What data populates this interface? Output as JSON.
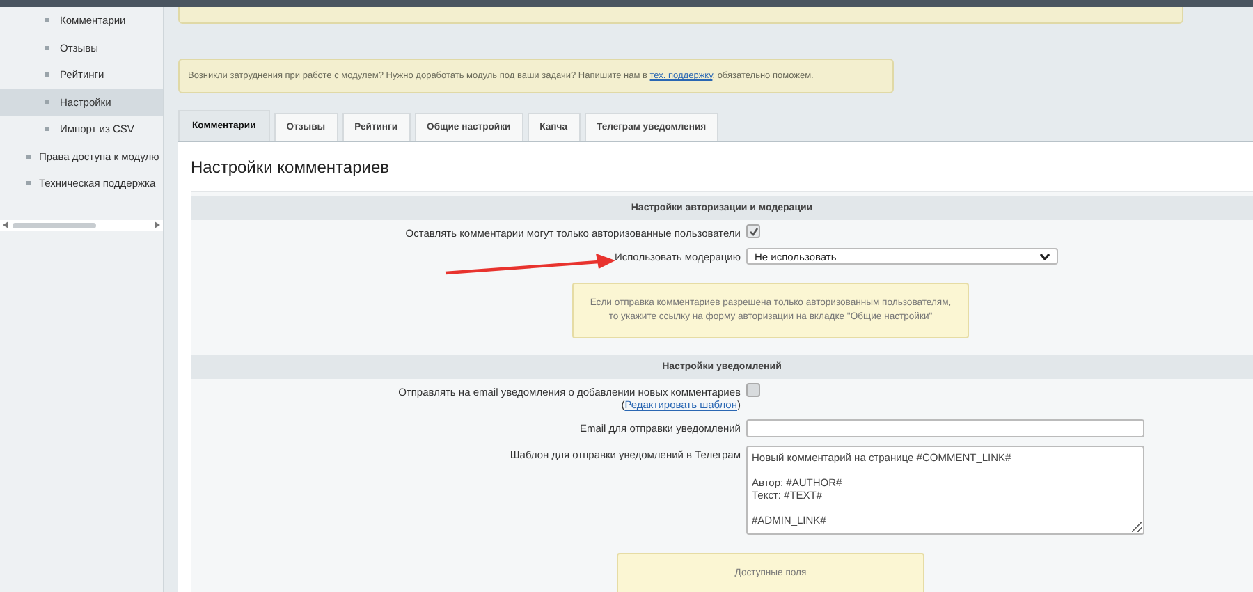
{
  "sidebar": {
    "items": [
      {
        "label": "Комментарии",
        "kind": "sub",
        "selected": false
      },
      {
        "label": "Отзывы",
        "kind": "sub",
        "selected": false
      },
      {
        "label": "Рейтинги",
        "kind": "sub",
        "selected": false
      },
      {
        "label": "Настройки",
        "kind": "sub",
        "selected": true
      },
      {
        "label": "Импорт из CSV",
        "kind": "sub",
        "selected": false
      },
      {
        "label": "Права доступа к модулю",
        "kind": "top",
        "selected": false
      },
      {
        "label": "Техническая поддержка",
        "kind": "top",
        "selected": false
      }
    ]
  },
  "notice": {
    "before": "Возникли затруднения при работе с модулем? Нужно доработать модуль под ваши задачи? Напишите нам в ",
    "link": "тех. поддержку",
    "after": ", обязательно поможем."
  },
  "tabs": [
    {
      "label": "Комментарии",
      "selected": true
    },
    {
      "label": "Отзывы",
      "selected": false
    },
    {
      "label": "Рейтинги",
      "selected": false
    },
    {
      "label": "Общие настройки",
      "selected": false
    },
    {
      "label": "Капча",
      "selected": false
    },
    {
      "label": "Телеграм уведомления",
      "selected": false
    }
  ],
  "page_title": "Настройки комментариев",
  "sections": [
    {
      "heading": "Настройки авторизации и модерации",
      "rows": [
        {
          "kind": "checkbox",
          "label": "Оставлять комментарии могут только авторизованные пользователи",
          "checked": true
        },
        {
          "kind": "select",
          "label": "Использовать модерацию",
          "value": "Не использовать"
        },
        {
          "kind": "hint",
          "lines": [
            "Если отправка комментариев разрешена только авторизованным пользователям,",
            "то укажите ссылку на форму авторизации на вкладке \"Общие настройки\""
          ]
        }
      ]
    },
    {
      "heading": "Настройки уведомлений",
      "rows": [
        {
          "kind": "checkbox",
          "label": "Отправлять на email уведомления о добавлении новых комментариев",
          "link_open": "(",
          "link": "Редактировать шаблон",
          "link_close": ")",
          "checked": false
        },
        {
          "kind": "input",
          "label": "Email для отправки уведомлений",
          "value": ""
        },
        {
          "kind": "textarea",
          "label": "Шаблон для отправки уведомлений в Телеграм",
          "value": "Новый комментарий на странице #COMMENT_LINK#\n\nАвтор: #AUTHOR#\nТекст: #TEXT#\n\n#ADMIN_LINK#"
        },
        {
          "kind": "hint",
          "lines": [
            "Доступные поля"
          ]
        }
      ]
    }
  ]
}
